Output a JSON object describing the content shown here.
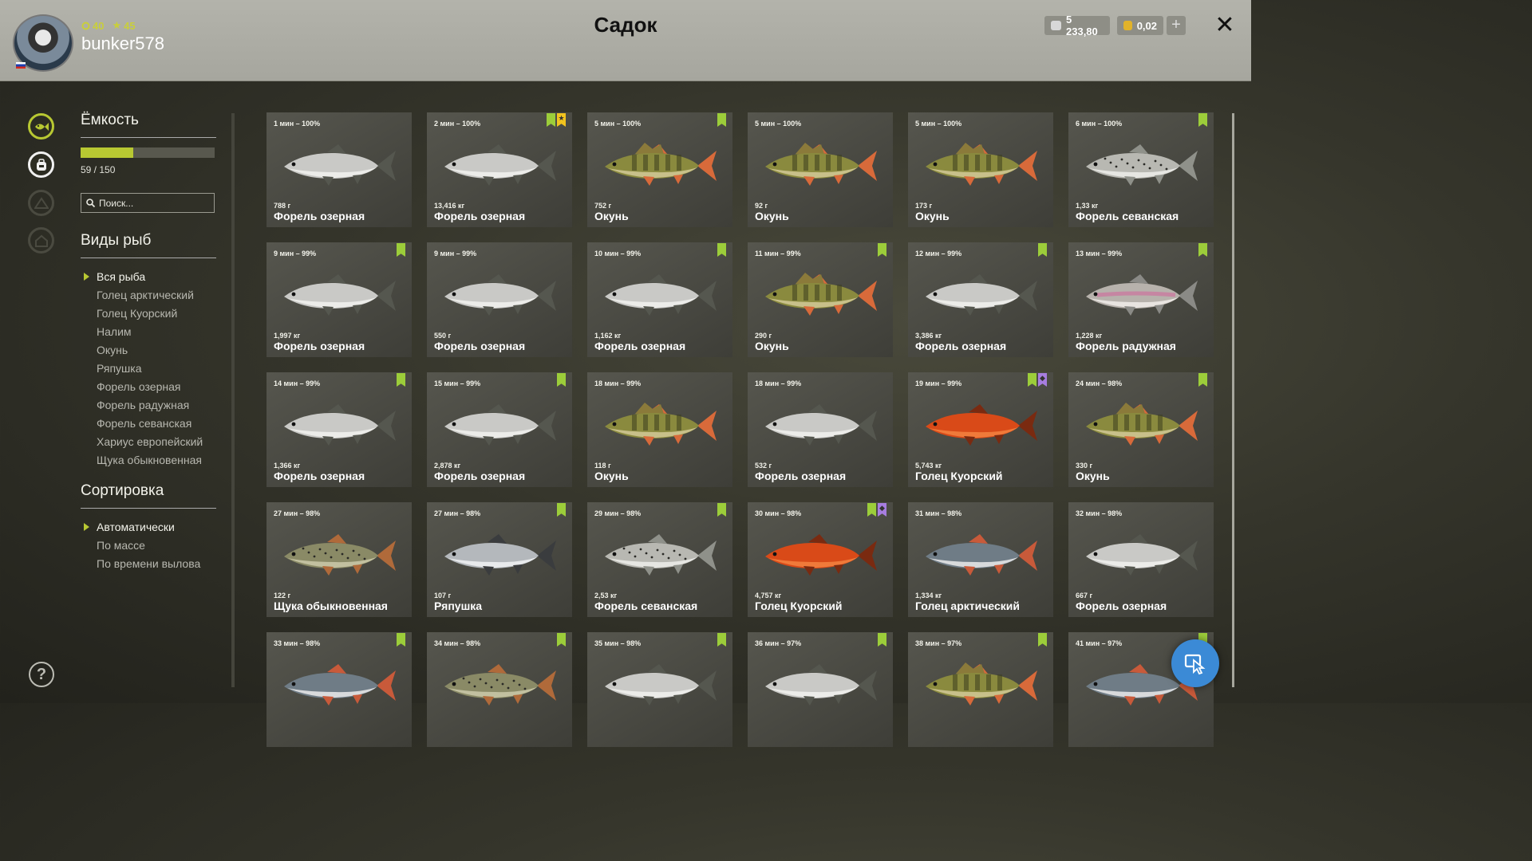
{
  "header": {
    "title": "Садок",
    "username": "bunker578",
    "level": "40",
    "stars": "45",
    "silver": "5 233,80",
    "gold": "0,02",
    "plus_label": "+",
    "close_label": "✕"
  },
  "capacity": {
    "title": "Ёмкость",
    "used": 59,
    "max": 150,
    "text": "59 / 150",
    "fill_fraction": 0.393
  },
  "search": {
    "placeholder": "Поиск..."
  },
  "species": {
    "title": "Виды рыб",
    "items": [
      "Вся рыба",
      "Голец арктический",
      "Голец Куорский",
      "Налим",
      "Окунь",
      "Ряпушка",
      "Форель озерная",
      "Форель радужная",
      "Форель севанская",
      "Хариус европейский",
      "Щука обыкновенная"
    ]
  },
  "sorting": {
    "title": "Сортировка",
    "items": [
      "Автоматически",
      "По массе",
      "По времени вылова"
    ]
  },
  "help_label": "?",
  "colors": {
    "accent": "#b8c832",
    "bookmark_green": "#9ccd3a",
    "bookmark_yellow": "#f2c31e",
    "bookmark_purple": "#a77de0",
    "fab_blue": "#3b8ad6"
  },
  "fish": [
    {
      "time": "1 мин – 100%",
      "weight": "788 г",
      "name": "Форель озерная",
      "kind": "trout",
      "marks": []
    },
    {
      "time": "2 мин – 100%",
      "weight": "13,416 кг",
      "name": "Форель озерная",
      "kind": "trout",
      "marks": [
        "green",
        "yellow"
      ]
    },
    {
      "time": "5 мин – 100%",
      "weight": "752 г",
      "name": "Окунь",
      "kind": "perch",
      "marks": [
        "green"
      ]
    },
    {
      "time": "5 мин – 100%",
      "weight": "92 г",
      "name": "Окунь",
      "kind": "perch",
      "marks": []
    },
    {
      "time": "5 мин – 100%",
      "weight": "173 г",
      "name": "Окунь",
      "kind": "perch",
      "marks": []
    },
    {
      "time": "6 мин – 100%",
      "weight": "1,33 кг",
      "name": "Форель севанская",
      "kind": "sevan",
      "marks": [
        "green"
      ]
    },
    {
      "time": "9 мин – 99%",
      "weight": "1,997 кг",
      "name": "Форель озерная",
      "kind": "trout",
      "marks": [
        "green"
      ]
    },
    {
      "time": "9 мин – 99%",
      "weight": "550 г",
      "name": "Форель озерная",
      "kind": "trout",
      "marks": []
    },
    {
      "time": "10 мин – 99%",
      "weight": "1,162 кг",
      "name": "Форель озерная",
      "kind": "trout",
      "marks": [
        "green"
      ]
    },
    {
      "time": "11 мин – 99%",
      "weight": "290 г",
      "name": "Окунь",
      "kind": "perch",
      "marks": [
        "green"
      ]
    },
    {
      "time": "12 мин – 99%",
      "weight": "3,386 кг",
      "name": "Форель озерная",
      "kind": "trout",
      "marks": [
        "green"
      ]
    },
    {
      "time": "13 мин – 99%",
      "weight": "1,228 кг",
      "name": "Форель радужная",
      "kind": "rainbow",
      "marks": [
        "green"
      ]
    },
    {
      "time": "14 мин – 99%",
      "weight": "1,366 кг",
      "name": "Форель озерная",
      "kind": "trout",
      "marks": [
        "green"
      ]
    },
    {
      "time": "15 мин – 99%",
      "weight": "2,878 кг",
      "name": "Форель озерная",
      "kind": "trout",
      "marks": [
        "green"
      ]
    },
    {
      "time": "18 мин – 99%",
      "weight": "118 г",
      "name": "Окунь",
      "kind": "perch",
      "marks": []
    },
    {
      "time": "18 мин – 99%",
      "weight": "532 г",
      "name": "Форель озерная",
      "kind": "trout",
      "marks": []
    },
    {
      "time": "19 мин – 99%",
      "weight": "5,743 кг",
      "name": "Голец Куорский",
      "kind": "charr",
      "marks": [
        "green",
        "purple"
      ]
    },
    {
      "time": "24 мин – 98%",
      "weight": "330 г",
      "name": "Окунь",
      "kind": "perch",
      "marks": [
        "green"
      ]
    },
    {
      "time": "27 мин – 98%",
      "weight": "122 г",
      "name": "Щука обыкновенная",
      "kind": "pike",
      "marks": []
    },
    {
      "time": "27 мин – 98%",
      "weight": "107 г",
      "name": "Ряпушка",
      "kind": "vendace",
      "marks": [
        "green"
      ]
    },
    {
      "time": "29 мин – 98%",
      "weight": "2,53 кг",
      "name": "Форель севанская",
      "kind": "sevan",
      "marks": [
        "green"
      ]
    },
    {
      "time": "30 мин – 98%",
      "weight": "4,757 кг",
      "name": "Голец Куорский",
      "kind": "charr",
      "marks": [
        "green",
        "purple"
      ]
    },
    {
      "time": "31 мин – 98%",
      "weight": "1,334 кг",
      "name": "Голец арктический",
      "kind": "arctic",
      "marks": []
    },
    {
      "time": "32 мин – 98%",
      "weight": "667 г",
      "name": "Форель озерная",
      "kind": "trout",
      "marks": []
    },
    {
      "time": "33 мин – 98%",
      "weight": "",
      "name": "",
      "kind": "arctic",
      "marks": [
        "green"
      ]
    },
    {
      "time": "34 мин – 98%",
      "weight": "",
      "name": "",
      "kind": "pike",
      "marks": [
        "green"
      ]
    },
    {
      "time": "35 мин – 98%",
      "weight": "",
      "name": "",
      "kind": "trout",
      "marks": [
        "green"
      ]
    },
    {
      "time": "36 мин – 97%",
      "weight": "",
      "name": "",
      "kind": "trout",
      "marks": [
        "green"
      ]
    },
    {
      "time": "38 мин – 97%",
      "weight": "",
      "name": "",
      "kind": "perch",
      "marks": [
        "green"
      ]
    },
    {
      "time": "41 мин – 97%",
      "weight": "",
      "name": "",
      "kind": "arctic",
      "marks": [
        "green"
      ]
    }
  ]
}
